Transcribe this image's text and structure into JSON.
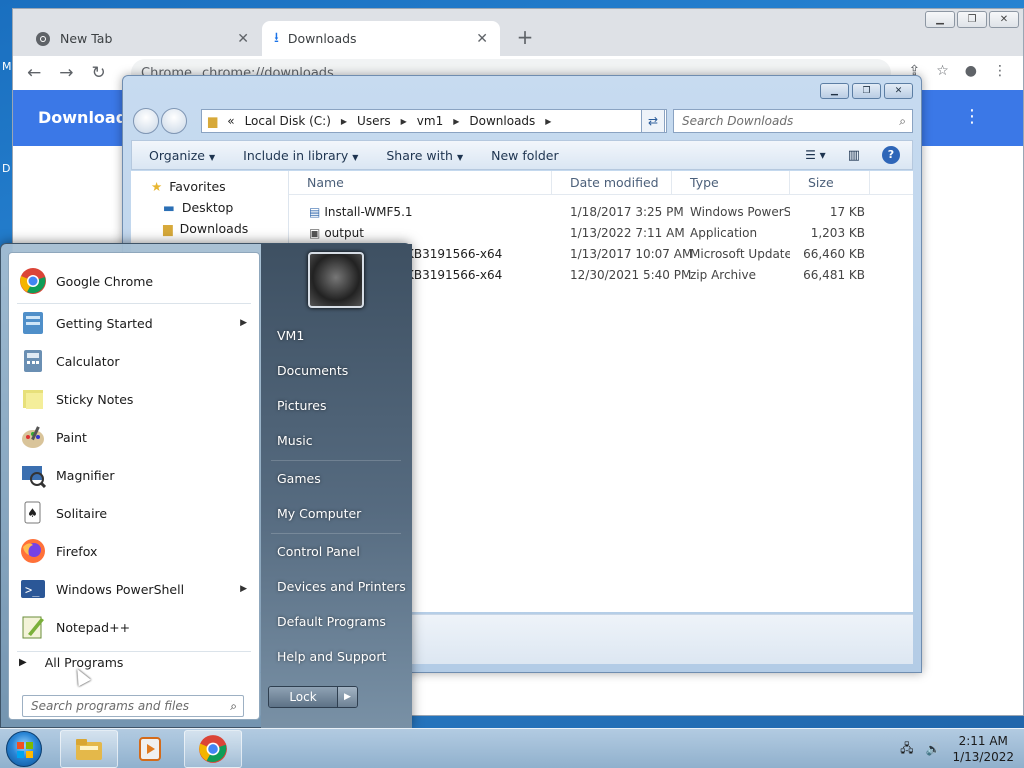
{
  "desktop": {
    "labels": [
      "M",
      "D"
    ]
  },
  "chrome": {
    "tabs": [
      {
        "title": "New Tab",
        "icon": "chrome-icon",
        "active": false
      },
      {
        "title": "Downloads",
        "icon": "download-icon",
        "active": true
      }
    ],
    "omnibox": {
      "site": "Chrome",
      "url": "chrome://downloads"
    },
    "page_title": "Downloads"
  },
  "explorer": {
    "breadcrumb": [
      "Local Disk (C:)",
      "Users",
      "vm1",
      "Downloads"
    ],
    "breadcrumb_prefix": "«",
    "search_placeholder": "Search Downloads",
    "commands": [
      "Organize",
      "Include in library",
      "Share with",
      "New folder"
    ],
    "nav": {
      "favorites": "Favorites",
      "desktop": "Desktop",
      "downloads": "Downloads"
    },
    "columns": {
      "name": "Name",
      "date": "Date modified",
      "type": "Type",
      "size": "Size"
    },
    "files": [
      {
        "name": "Install-WMF5.1",
        "date": "1/18/2017 3:25 PM",
        "type": "Windows PowerS...",
        "size": "17 KB"
      },
      {
        "name": "output",
        "date": "1/13/2022 7:11 AM",
        "type": "Application",
        "size": "1,203 KB"
      },
      {
        "name": "2-KB3191566-x64",
        "date": "1/13/2017 10:07 AM",
        "type": "Microsoft Update ...",
        "size": "66,460 KB"
      },
      {
        "name": "2-KB3191566-x64",
        "date": "12/30/2021 5:40 PM",
        "type": "zip Archive",
        "size": "66,481 KB"
      }
    ]
  },
  "startmenu": {
    "programs": [
      {
        "label": "Google Chrome",
        "icon": "chrome-icon",
        "submenu": false
      },
      {
        "label": "Getting Started",
        "icon": "getting-started-icon",
        "submenu": true
      },
      {
        "label": "Calculator",
        "icon": "calculator-icon",
        "submenu": false
      },
      {
        "label": "Sticky Notes",
        "icon": "sticky-notes-icon",
        "submenu": false
      },
      {
        "label": "Paint",
        "icon": "paint-icon",
        "submenu": false
      },
      {
        "label": "Magnifier",
        "icon": "magnifier-icon",
        "submenu": false
      },
      {
        "label": "Solitaire",
        "icon": "solitaire-icon",
        "submenu": false
      },
      {
        "label": "Firefox",
        "icon": "firefox-icon",
        "submenu": false
      },
      {
        "label": "Windows PowerShell",
        "icon": "powershell-icon",
        "submenu": true
      },
      {
        "label": "Notepad++",
        "icon": "notepadpp-icon",
        "submenu": false
      }
    ],
    "all_programs": "All Programs",
    "search_placeholder": "Search programs and files",
    "right_items": [
      "VM1",
      "Documents",
      "Pictures",
      "Music",
      "Games",
      "My Computer",
      "Control Panel",
      "Devices and Printers",
      "Default Programs",
      "Help and Support"
    ],
    "lock_label": "Lock"
  },
  "taskbar": {
    "time": "2:11 AM",
    "date": "1/13/2022"
  },
  "colors": {
    "chrome_header": "#3b78e7",
    "taskbar": "#a8c4de"
  }
}
